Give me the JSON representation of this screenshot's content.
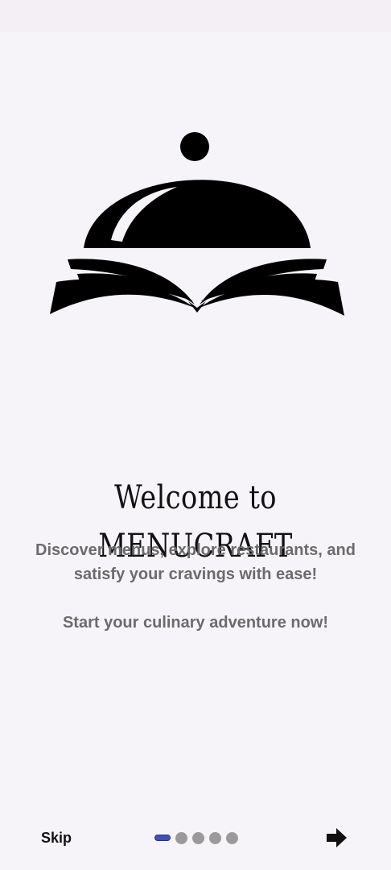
{
  "app": {
    "name": "MENUCRAFT"
  },
  "onboarding": {
    "title": "Welcome to MENUCRAFT",
    "subtitle": "Discover menus, explore restaurants, and satisfy your cravings with ease!",
    "cta_text": "Start your culinary adventure now!",
    "page_index": 1,
    "page_count": 5
  },
  "navigation": {
    "skip_label": "Skip",
    "next_icon": "arrow-right-icon"
  },
  "colors": {
    "background": "#f6f4f8",
    "active_dot": "#3f51b5",
    "inactive_dot": "#9a9a9a",
    "text_muted": "#6b6b6b"
  }
}
